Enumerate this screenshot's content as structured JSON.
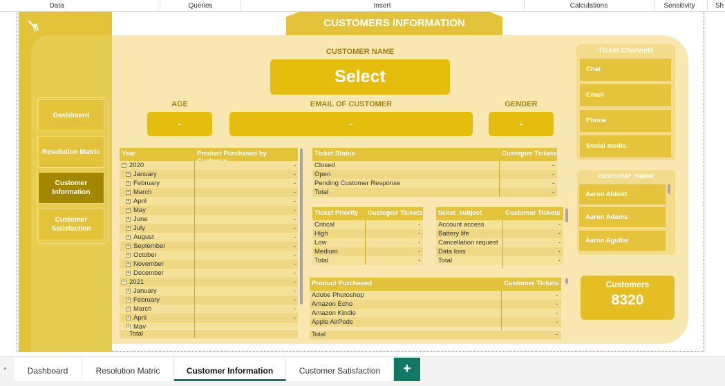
{
  "ribbon": [
    "Data",
    "Queries",
    "Insert",
    "Calculations",
    "Sensitivity",
    "Sh"
  ],
  "title": "CUSTOMERS INFORMATION",
  "nav": [
    {
      "label": "Dashboard",
      "active": false
    },
    {
      "label": "Resolution Matric",
      "active": false
    },
    {
      "label": "Customer Information",
      "active": true
    },
    {
      "label": "Customer Satisfaction",
      "active": false
    }
  ],
  "customer_name": {
    "label": "CUSTOMER NAME",
    "value": "Select"
  },
  "age": {
    "label": "AGE",
    "value": "-"
  },
  "email": {
    "label": "EMAIL OF CUSTOMER",
    "value": "-"
  },
  "gender": {
    "label": "GENDER",
    "value": "-"
  },
  "year_table": {
    "headers": [
      "Year",
      "Product Purchased by Customer"
    ],
    "rows": [
      {
        "label": "2020",
        "level": 0,
        "value": "-"
      },
      {
        "label": "January",
        "level": 1,
        "value": "-"
      },
      {
        "label": "February",
        "level": 1,
        "value": "-"
      },
      {
        "label": "March",
        "level": 1,
        "value": "-"
      },
      {
        "label": "April",
        "level": 1,
        "value": "-"
      },
      {
        "label": "May",
        "level": 1,
        "value": "-"
      },
      {
        "label": "June",
        "level": 1,
        "value": "-"
      },
      {
        "label": "July",
        "level": 1,
        "value": "-"
      },
      {
        "label": "August",
        "level": 1,
        "value": "-"
      },
      {
        "label": "September",
        "level": 1,
        "value": "-"
      },
      {
        "label": "October",
        "level": 1,
        "value": "-"
      },
      {
        "label": "November",
        "level": 1,
        "value": "-"
      },
      {
        "label": "December",
        "level": 1,
        "value": "-"
      },
      {
        "label": "2021",
        "level": 0,
        "value": "-"
      },
      {
        "label": "January",
        "level": 1,
        "value": "-"
      },
      {
        "label": "February",
        "level": 1,
        "value": "-"
      },
      {
        "label": "March",
        "level": 1,
        "value": "-"
      },
      {
        "label": "April",
        "level": 1,
        "value": "-"
      },
      {
        "label": "May",
        "level": 1,
        "value": "-"
      }
    ],
    "total": "Total"
  },
  "status_table": {
    "headers": [
      "Ticket Status",
      "Customer Tickets"
    ],
    "rows": [
      {
        "label": "Closed",
        "value": "-"
      },
      {
        "label": "Open",
        "value": "-"
      },
      {
        "label": "Pending Customer Response",
        "value": "-"
      },
      {
        "label": "Total",
        "value": "-"
      }
    ]
  },
  "priority_table": {
    "headers": [
      "Ticket Priority",
      "Customer Tickets"
    ],
    "rows": [
      {
        "label": "Critical",
        "value": "-"
      },
      {
        "label": "High",
        "value": "-"
      },
      {
        "label": "Low",
        "value": "-"
      },
      {
        "label": "Medium",
        "value": "-"
      },
      {
        "label": "Total",
        "value": "-"
      }
    ]
  },
  "subject_table": {
    "headers": [
      "ticket_subject",
      "Customer Tickets"
    ],
    "rows": [
      {
        "label": "Account access",
        "value": "-"
      },
      {
        "label": "Battery life",
        "value": "-"
      },
      {
        "label": "Cancellation request",
        "value": "-"
      },
      {
        "label": "Data loss",
        "value": "-"
      },
      {
        "label": "Total",
        "value": "-"
      }
    ]
  },
  "product_table": {
    "headers": [
      "Product Purchased",
      "Customer Tickets"
    ],
    "rows": [
      {
        "label": "Adobe Photoshop",
        "value": "-"
      },
      {
        "label": "Amazon Echo",
        "value": "-"
      },
      {
        "label": "Amazon Kindle",
        "value": "-"
      },
      {
        "label": "Apple AirPods",
        "value": "-"
      }
    ],
    "total": {
      "label": "Total",
      "value": "-"
    }
  },
  "channels": {
    "title": "Ticket Channels",
    "items": [
      "Chat",
      "Email",
      "Phone",
      "Social media"
    ]
  },
  "customer_list": {
    "title": "customer_name",
    "items": [
      "Aaron Abbott",
      "Aaron Adams",
      "Aaron Aguilar"
    ]
  },
  "kpi": {
    "label": "Customers",
    "value": "8320"
  },
  "page_tabs": [
    {
      "label": "Dashboard",
      "active": false
    },
    {
      "label": "Resolution Matric",
      "active": false
    },
    {
      "label": "Customer Information",
      "active": true
    },
    {
      "label": "Customer Satisfaction",
      "active": false
    }
  ],
  "add_tab": "+",
  "colors": {
    "accent": "#e2c33a",
    "panel": "#f8e7b0",
    "active_nav": "#a48700",
    "tab_accent": "#117865"
  }
}
